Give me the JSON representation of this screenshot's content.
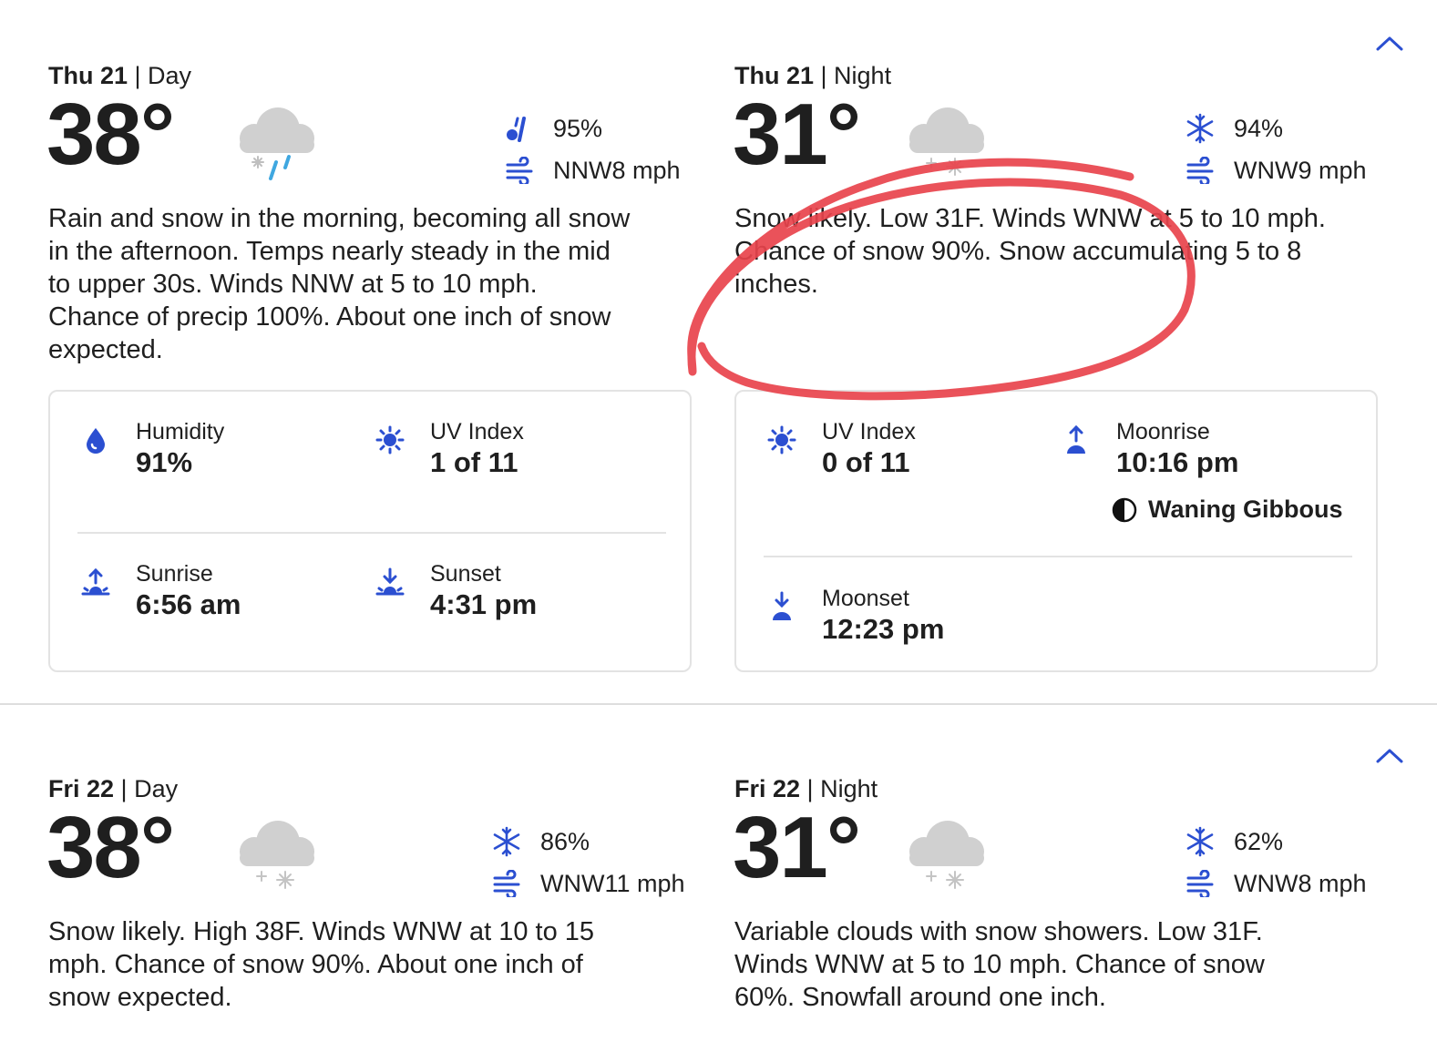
{
  "colors": {
    "accent": "#2b4fd1",
    "text": "#1f1f1f",
    "annotation": "#e8434c",
    "cloud": "#d0d0d0",
    "rain": "#3fa7e0"
  },
  "sections": [
    {
      "day": {
        "day_label": "Thu 21",
        "part": "Day",
        "temp": "38°",
        "condition_icon": "rain-snow-icon",
        "precip": {
          "icon": "rain-snow-precip-icon",
          "value": "95%"
        },
        "wind": {
          "icon": "wind-icon",
          "value": "NNW8 mph"
        },
        "narrative": "Rain and snow in the morning, becoming all snow in the afternoon. Temps nearly steady in the mid to upper 30s. Winds NNW at 5 to 10 mph. Chance of precip 100%. About one inch of snow expected.",
        "details": {
          "humidity": {
            "label": "Humidity",
            "value": "91%"
          },
          "uv": {
            "label": "UV Index",
            "value": "1 of 11"
          },
          "sunrise": {
            "label": "Sunrise",
            "value": "6:56 am"
          },
          "sunset": {
            "label": "Sunset",
            "value": "4:31 pm"
          }
        }
      },
      "night": {
        "day_label": "Thu 21",
        "part": "Night",
        "temp": "31°",
        "condition_icon": "snow-icon",
        "precip": {
          "icon": "snowflake-icon",
          "value": "94%"
        },
        "wind": {
          "icon": "wind-icon",
          "value": "WNW9 mph"
        },
        "narrative": "Snow likely. Low 31F. Winds WNW at 5 to 10 mph. Chance of snow 90%. Snow accumulating 5 to 8 inches.",
        "details": {
          "uv": {
            "label": "UV Index",
            "value": "0 of 11"
          },
          "moonrise": {
            "label": "Moonrise",
            "value": "10:16 pm"
          },
          "moon_phase": "Waning Gibbous",
          "moonset": {
            "label": "Moonset",
            "value": "12:23 pm"
          }
        }
      }
    },
    {
      "day": {
        "day_label": "Fri 22",
        "part": "Day",
        "temp": "38°",
        "condition_icon": "snow-icon",
        "precip": {
          "icon": "snowflake-icon",
          "value": "86%"
        },
        "wind": {
          "icon": "wind-icon",
          "value": "WNW11 mph"
        },
        "narrative": "Snow likely. High 38F. Winds WNW at 10 to 15 mph. Chance of snow 90%. About one inch of snow expected."
      },
      "night": {
        "day_label": "Fri 22",
        "part": "Night",
        "temp": "31°",
        "condition_icon": "snow-icon",
        "precip": {
          "icon": "snowflake-icon",
          "value": "62%"
        },
        "wind": {
          "icon": "wind-icon",
          "value": "WNW8 mph"
        },
        "narrative": "Variable clouds with snow showers. Low 31F. Winds WNW at 5 to 10 mph. Chance of snow 60%. Snowfall around one inch."
      }
    }
  ]
}
